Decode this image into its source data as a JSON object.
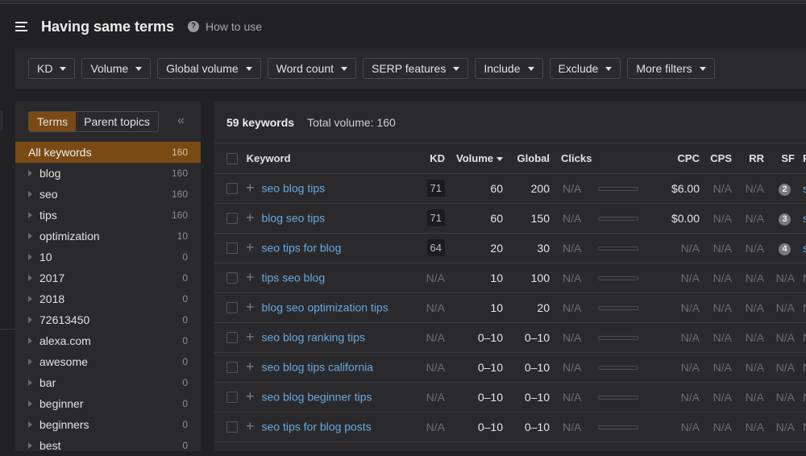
{
  "header": {
    "title": "Having same terms",
    "help_label": "How to use",
    "help_icon": "?"
  },
  "filters": [
    "KD",
    "Volume",
    "Global volume",
    "Word count",
    "SERP features",
    "Include",
    "Exclude",
    "More filters"
  ],
  "sidebar": {
    "tabs": [
      {
        "label": "Terms",
        "active": true
      },
      {
        "label": "Parent topics",
        "active": false
      }
    ],
    "collapse_icon": "«",
    "terms": [
      {
        "name": "All keywords",
        "count": "160",
        "active": true
      },
      {
        "name": "blog",
        "count": "160"
      },
      {
        "name": "seo",
        "count": "160"
      },
      {
        "name": "tips",
        "count": "160"
      },
      {
        "name": "optimization",
        "count": "10"
      },
      {
        "name": "10",
        "count": "0"
      },
      {
        "name": "2017",
        "count": "0"
      },
      {
        "name": "2018",
        "count": "0"
      },
      {
        "name": "72613450",
        "count": "0"
      },
      {
        "name": "alexa.com",
        "count": "0"
      },
      {
        "name": "awesome",
        "count": "0"
      },
      {
        "name": "bar",
        "count": "0"
      },
      {
        "name": "beginner",
        "count": "0"
      },
      {
        "name": "beginners",
        "count": "0"
      },
      {
        "name": "best",
        "count": "0"
      }
    ]
  },
  "summary": {
    "keyword_count": "59 keywords",
    "total_volume": "Total volume: 160"
  },
  "table": {
    "columns": [
      "Keyword",
      "KD",
      "Volume",
      "Global",
      "Clicks",
      "",
      "CPC",
      "CPS",
      "RR",
      "SF",
      "PA"
    ],
    "rows": [
      {
        "keyword": "seo blog tips",
        "kd": "71",
        "volume": "60",
        "global": "200",
        "clicks": "N/A",
        "cpc": "$6.00",
        "cps": "N/A",
        "rr": "N/A",
        "sf": "2",
        "parent": "se"
      },
      {
        "keyword": "blog seo tips",
        "kd": "71",
        "volume": "60",
        "global": "150",
        "clicks": "N/A",
        "cpc": "$0.00",
        "cps": "N/A",
        "rr": "N/A",
        "sf": "3",
        "parent": "se"
      },
      {
        "keyword": "seo tips for blog",
        "kd": "64",
        "volume": "20",
        "global": "30",
        "clicks": "N/A",
        "cpc": "N/A",
        "cps": "N/A",
        "rr": "N/A",
        "sf": "4",
        "parent": "se"
      },
      {
        "keyword": "tips seo blog",
        "kd": "N/A",
        "volume": "10",
        "global": "100",
        "clicks": "N/A",
        "cpc": "N/A",
        "cps": "N/A",
        "rr": "N/A",
        "sf": "N/A",
        "parent": "N/A"
      },
      {
        "keyword": "blog seo optimization tips",
        "kd": "N/A",
        "volume": "10",
        "global": "20",
        "clicks": "N/A",
        "cpc": "N/A",
        "cps": "N/A",
        "rr": "N/A",
        "sf": "N/A",
        "parent": "N/A"
      },
      {
        "keyword": "seo blog ranking tips",
        "kd": "N/A",
        "volume": "0–10",
        "global": "0–10",
        "clicks": "N/A",
        "cpc": "N/A",
        "cps": "N/A",
        "rr": "N/A",
        "sf": "N/A",
        "parent": "N/A"
      },
      {
        "keyword": "seo blog tips california",
        "kd": "N/A",
        "volume": "0–10",
        "global": "0–10",
        "clicks": "N/A",
        "cpc": "N/A",
        "cps": "N/A",
        "rr": "N/A",
        "sf": "N/A",
        "parent": "N/A"
      },
      {
        "keyword": "seo blog beginner tips",
        "kd": "N/A",
        "volume": "0–10",
        "global": "0–10",
        "clicks": "N/A",
        "cpc": "N/A",
        "cps": "N/A",
        "rr": "N/A",
        "sf": "N/A",
        "parent": "N/A"
      },
      {
        "keyword": "seo tips for blog posts",
        "kd": "N/A",
        "volume": "0–10",
        "global": "0–10",
        "clicks": "N/A",
        "cpc": "N/A",
        "cps": "N/A",
        "rr": "N/A",
        "sf": "N/A",
        "parent": "N/A"
      }
    ]
  },
  "colors": {
    "accent": "#7a4a14",
    "link": "#6aa9dc",
    "background": "#212123",
    "panel": "#2a2a2d"
  }
}
